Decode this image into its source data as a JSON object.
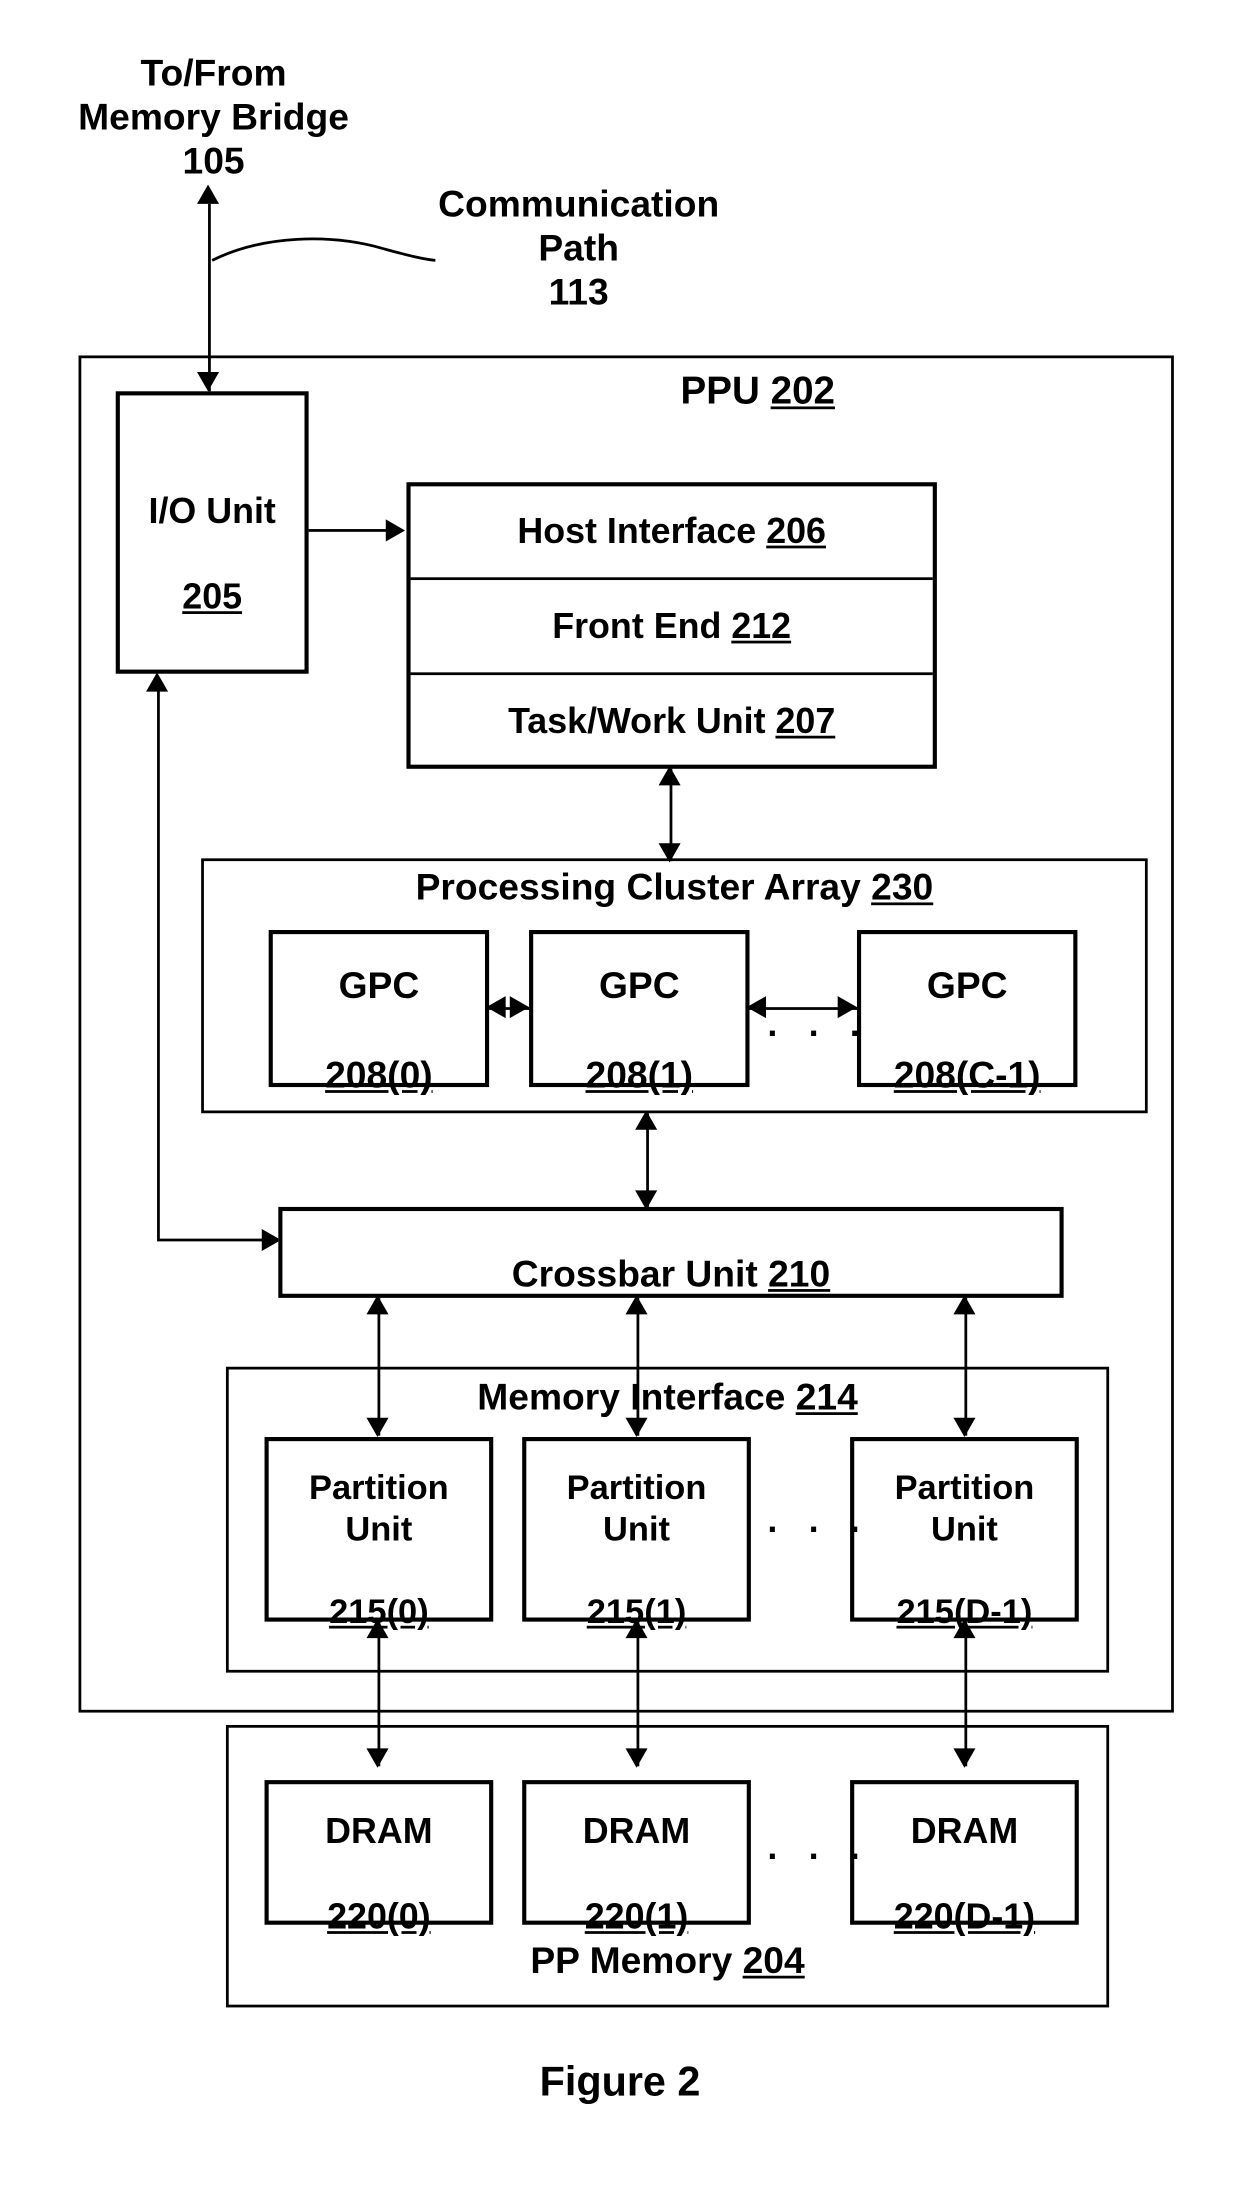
{
  "figure": {
    "caption": "Figure 2"
  },
  "external_labels": {
    "memory_bridge": "To/From\nMemory Bridge\n105",
    "communication_path": "Communication\nPath\n113"
  },
  "ppu": {
    "title_text": "PPU ",
    "title_ref": "202"
  },
  "io_unit": {
    "name": "I/O Unit",
    "ref": "205"
  },
  "front_stack": [
    {
      "name": "Host Interface ",
      "ref": "206"
    },
    {
      "name": "Front End ",
      "ref": "212"
    },
    {
      "name": "Task/Work Unit ",
      "ref": "207"
    }
  ],
  "processing_cluster_array": {
    "title_text": "Processing Cluster Array ",
    "title_ref": "230",
    "ellipsis": "· · ·",
    "gpcs": [
      {
        "name": "GPC",
        "ref": "208(0)"
      },
      {
        "name": "GPC",
        "ref": "208(1)"
      },
      {
        "name": "GPC",
        "ref": "208(C-1)"
      }
    ]
  },
  "crossbar_unit": {
    "name": "Crossbar Unit ",
    "ref": "210"
  },
  "memory_interface": {
    "title_text": "Memory Interface ",
    "title_ref": "214",
    "ellipsis": "· · ·",
    "partitions": [
      {
        "name": "Partition\nUnit",
        "ref": "215(0)"
      },
      {
        "name": "Partition\nUnit",
        "ref": "215(1)"
      },
      {
        "name": "Partition\nUnit",
        "ref": "215(D-1)"
      }
    ]
  },
  "pp_memory": {
    "title_text": "PP Memory ",
    "title_ref": "204",
    "ellipsis": "· · ·",
    "drams": [
      {
        "name": "DRAM",
        "ref": "220(0)"
      },
      {
        "name": "DRAM",
        "ref": "220(1)"
      },
      {
        "name": "DRAM",
        "ref": "220(D-1)"
      }
    ]
  },
  "colors": {
    "ink": "#000000",
    "paper": "#ffffff"
  }
}
